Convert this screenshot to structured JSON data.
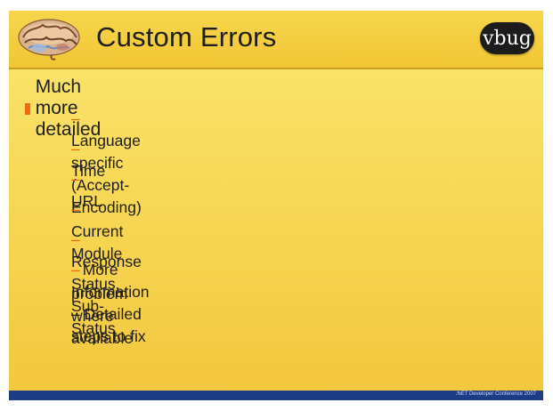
{
  "slide": {
    "title": "Custom Errors",
    "logo_text": "vbug",
    "main_bullet": "Much more detailed",
    "sub_bullets": [
      "Language specific (Accept-Encoding)",
      "Time",
      "URL",
      "Current Module",
      "Response Status, Sub-Status",
      "More Information – Detailed steps to fix",
      "problem where available"
    ],
    "dash_char": "–",
    "footer_left": "",
    "footer_right": ".NET Developer Conference 2007"
  },
  "colors": {
    "accent": "#f26a0f",
    "footer": "#1e3c86",
    "background": "#f7d957"
  },
  "icons": {
    "brain": "brain-icon",
    "bullet": "square-bullet-icon"
  }
}
